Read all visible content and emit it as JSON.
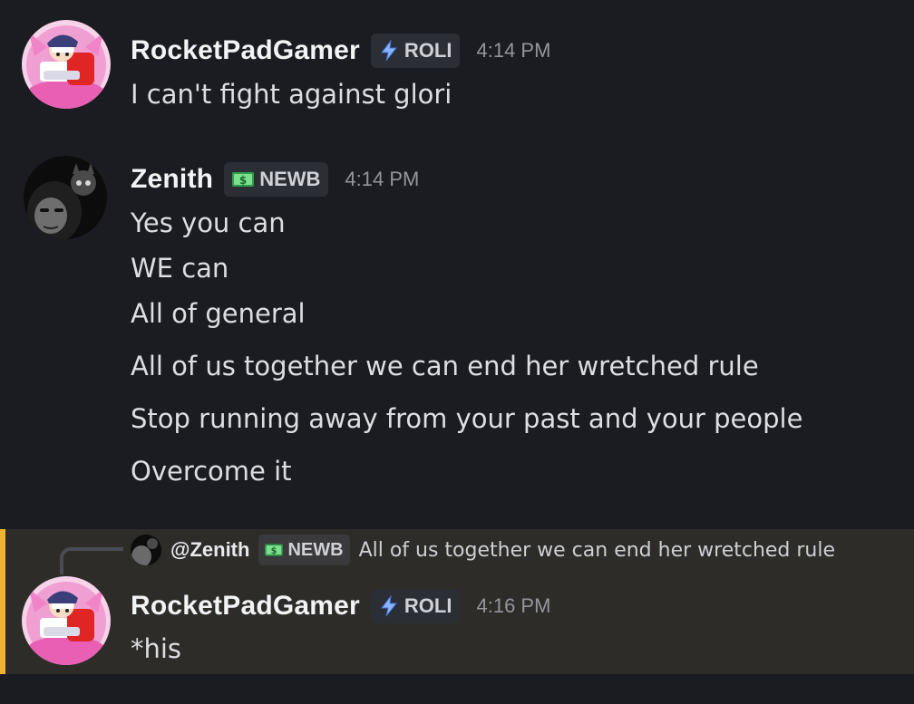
{
  "messages": [
    {
      "author": "RocketPadGamer",
      "tag": "ROLI",
      "tag_icon": "lightning-icon",
      "time": "4:14 PM",
      "lines": [
        "I can't fight against glori"
      ]
    },
    {
      "author": "Zenith",
      "tag": "NEWB",
      "tag_icon": "money-icon",
      "time": "4:14 PM",
      "lines": [
        "Yes you can",
        "WE can",
        "All of general",
        "All of us together we can end her wretched rule",
        "Stop running away from your past and your people",
        "Overcome it"
      ]
    },
    {
      "author": "RocketPadGamer",
      "tag": "ROLI",
      "tag_icon": "lightning-icon",
      "time": "4:16 PM",
      "lines": [
        "*his"
      ],
      "reply": {
        "author": "@Zenith",
        "tag": "NEWB",
        "tag_icon": "money-icon",
        "content": "All of us together we can end her wretched rule"
      }
    }
  ],
  "colors": {
    "background": "#1b1c21",
    "mention_highlight": "#2d2c29",
    "mention_bar": "#f0b232",
    "username": "#f2f3f5",
    "timestamp": "#94959c",
    "tag_bg": "#2c2e35"
  }
}
